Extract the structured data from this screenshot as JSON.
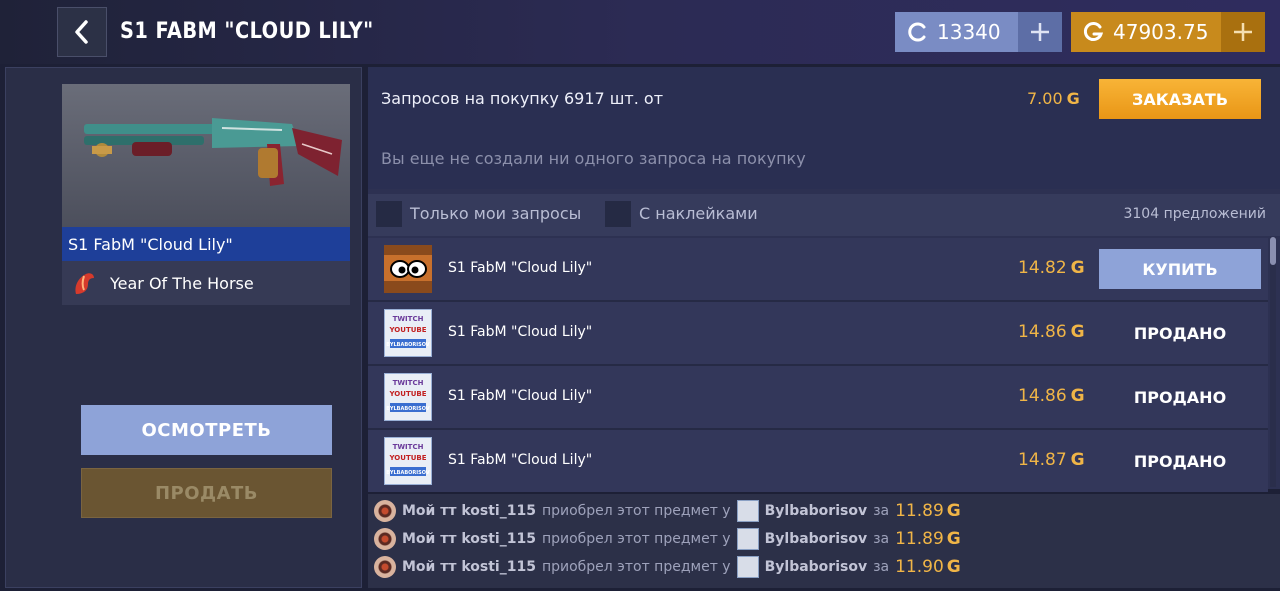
{
  "header": {
    "title": "S1 FABM \"CLOUD LILY\"",
    "silver_balance": "13340",
    "gold_balance": "47903.75"
  },
  "colors": {
    "gold": "#f0b547",
    "order_button": "#f2a424",
    "buy_button": "#8ea3d8",
    "selected_name_bar": "#1e3f99"
  },
  "item": {
    "name": "S1 FabM \"Cloud Lily\"",
    "collection": "Year Of The Horse",
    "icons": {
      "back": "chevron-left-icon",
      "collection": "horse-icon",
      "currency_gold": "g-coin-icon",
      "currency_silver": "c-coin-icon"
    }
  },
  "actions": {
    "inspect": "ОСМОТРЕТЬ",
    "sell": "ПРОДАТЬ"
  },
  "requests": {
    "label": "Запросов на покупку 6917 шт. от",
    "price": "7.00",
    "order_button": "ЗАКАЗАТЬ",
    "empty_message": "Вы еще не создали ни одного запроса на покупку"
  },
  "filters": {
    "only_mine": "Только мои запросы",
    "with_stickers": "С наклейками",
    "offers_count": "3104 предложений"
  },
  "currency_symbol": "G",
  "listings": [
    {
      "name": "S1 FabM \"Cloud Lily\"",
      "price": "14.82",
      "action": "КУПИТЬ",
      "sold": false,
      "thumb": "eyes"
    },
    {
      "name": "S1 FabM \"Cloud Lily\"",
      "price": "14.86",
      "action": "ПРОДАНО",
      "sold": true,
      "thumb": "twitch"
    },
    {
      "name": "S1 FabM \"Cloud Lily\"",
      "price": "14.86",
      "action": "ПРОДАНО",
      "sold": true,
      "thumb": "twitch"
    },
    {
      "name": "S1 FabM \"Cloud Lily\"",
      "price": "14.87",
      "action": "ПРОДАНО",
      "sold": true,
      "thumb": "twitch"
    }
  ],
  "thumb_text": {
    "line1": "TWITCH",
    "line2": "YOUTUBE",
    "line3": "BYLBABORISOV"
  },
  "history": [
    {
      "buyer": "Мой тт kosti_115",
      "verb": "приобрел этот предмет у",
      "seller": "Bylbaborisov",
      "za": "за",
      "price": "11.89"
    },
    {
      "buyer": "Мой тт kosti_115",
      "verb": "приобрел этот предмет у",
      "seller": "Bylbaborisov",
      "za": "за",
      "price": "11.89"
    },
    {
      "buyer": "Мой тт kosti_115",
      "verb": "приобрел этот предмет у",
      "seller": "Bylbaborisov",
      "za": "за",
      "price": "11.90"
    }
  ]
}
